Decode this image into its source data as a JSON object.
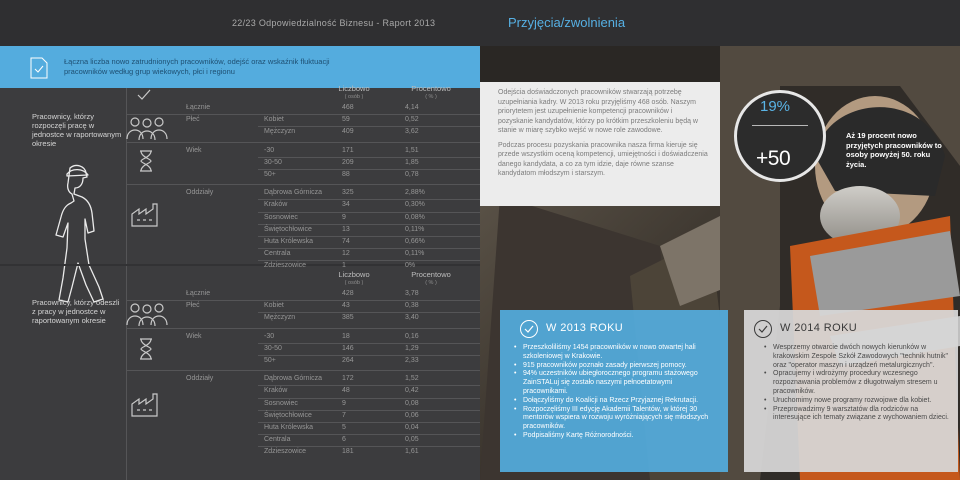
{
  "header": {
    "page_label": "22/23  Odpowiedzialność Biznesu - Raport 2013",
    "section_title": "Przyjęcia/zwolnienia"
  },
  "intro": {
    "text": "Łączna liczba nowo zatrudnionych pracowników, odejść oraz wskaźnik fluktuacji pracowników według grup wiekowych, płci i regionu"
  },
  "hired": {
    "label": "Pracownicy, którzy rozpoczęli pracę w jednostce w raportowanym okresie",
    "col_count": "Liczbowo",
    "col_count_unit": "( osób )",
    "col_pct": "Procentowo",
    "col_pct_unit": "( % )",
    "total": {
      "label": "Łącznie",
      "count": "468",
      "pct": "4,14"
    },
    "gender": {
      "label": "Płeć",
      "rows": [
        {
          "name": "Kobiet",
          "count": "59",
          "pct": "0,52"
        },
        {
          "name": "Mężczyzn",
          "count": "409",
          "pct": "3,62"
        }
      ]
    },
    "age": {
      "label": "Wiek",
      "rows": [
        {
          "name": "-30",
          "count": "171",
          "pct": "1,51"
        },
        {
          "name": "30-50",
          "count": "209",
          "pct": "1,85"
        },
        {
          "name": "50+",
          "count": "88",
          "pct": "0,78"
        }
      ]
    },
    "branches": {
      "label": "Oddziały",
      "rows": [
        {
          "name": "Dąbrowa Górnicza",
          "count": "325",
          "pct": "2,88%"
        },
        {
          "name": "Kraków",
          "count": "34",
          "pct": "0,30%"
        },
        {
          "name": "Sosnowiec",
          "count": "9",
          "pct": "0,08%"
        },
        {
          "name": "Świętochłowice",
          "count": "13",
          "pct": "0,11%"
        },
        {
          "name": "Huta Królewska",
          "count": "74",
          "pct": "0,66%"
        },
        {
          "name": "Centrala",
          "count": "12",
          "pct": "0,11%"
        },
        {
          "name": "Zdzieszowice",
          "count": "1",
          "pct": "0%"
        }
      ]
    }
  },
  "left": {
    "label": "Pracownicy, którzy odeszli z pracy w jednostce w raportowanym okresie",
    "col_count": "Liczbowo",
    "col_count_unit": "( osób )",
    "col_pct": "Procentowo",
    "col_pct_unit": "( % )",
    "total": {
      "label": "Łącznie",
      "count": "428",
      "pct": "3,78"
    },
    "gender": {
      "label": "Płeć",
      "rows": [
        {
          "name": "Kobiet",
          "count": "43",
          "pct": "0,38"
        },
        {
          "name": "Mężczyzn",
          "count": "385",
          "pct": "3,40"
        }
      ]
    },
    "age": {
      "label": "Wiek",
      "rows": [
        {
          "name": "-30",
          "count": "18",
          "pct": "0,16"
        },
        {
          "name": "30-50",
          "count": "146",
          "pct": "1,29"
        },
        {
          "name": "50+",
          "count": "264",
          "pct": "2,33"
        }
      ]
    },
    "branches": {
      "label": "Oddziały",
      "rows": [
        {
          "name": "Dąbrowa Górnicza",
          "count": "172",
          "pct": "1,52"
        },
        {
          "name": "Kraków",
          "count": "48",
          "pct": "0,42"
        },
        {
          "name": "Sosnowiec",
          "count": "9",
          "pct": "0,08"
        },
        {
          "name": "Świętochłowice",
          "count": "7",
          "pct": "0,06"
        },
        {
          "name": "Huta Królewska",
          "count": "5",
          "pct": "0,04"
        },
        {
          "name": "Centrala",
          "count": "6",
          "pct": "0,05"
        },
        {
          "name": "Zdzieszowice",
          "count": "181",
          "pct": "1,61"
        }
      ]
    }
  },
  "info_box": {
    "p1": "Odejścia doświadczonych pracowników stwarzają potrzebę uzupełniania kadry. W 2013 roku przyjęliśmy 468 osób. Naszym priorytetem jest uzupełnienie kompetencji pracowników i pozyskanie kandydatów, którzy po krótkim przeszkoleniu będą w stanie w miarę szybko wejść w nowe role zawodowe.",
    "p2": "Podczas procesu pozyskania pracownika nasza firma kieruje się przede wszystkim oceną kompetencji, umiejętności i doświadczenia danego kandydata, a co za tym idzie, daje równe szanse kandydatom młodszym i starszym."
  },
  "stat": {
    "percent": "19%",
    "age": "+50",
    "text": "Aż 19 procent nowo przyjętych pracowników to osoby powyżej 50. roku życia."
  },
  "year2013": {
    "title": "W 2013 ROKU",
    "items": [
      "Przeszkoliliśmy 1454 pracowników w nowo otwartej hali szkoleniowej w Krakowie.",
      "915 pracowników poznało zasady pierwszej pomocy.",
      "94% uczestników ubiegłorocznego programu stażowego ZainSTALuj się zostało naszymi pełnoetatowymi pracownikami.",
      "Dołączyliśmy do Koalicji na Rzecz Przyjaznej Rekrutacji.",
      "Rozpoczęliśmy III edycję Akademii Talentów, w której 30 mentorów wspiera w rozwoju wyróżniających się młodszych pracowników.",
      "Podpisaliśmy Kartę Różnorodności."
    ]
  },
  "year2014": {
    "title": "W 2014 ROKU",
    "items": [
      "Wesprzemy otwarcie dwóch nowych kierunków w krakowskim Zespole Szkół Zawodowych \"technik hutnik\" oraz \"operator maszyn i urządzeń metalurgicznych\".",
      "Opracujemy i wdrożymy procedury wczesnego rozpoznawania problemów z długotrwałym stresem u pracowników.",
      "Uruchomimy nowe programy rozwojowe dla kobiet.",
      "Przeprowadzimy 9 warsztatów dla rodziców na interesujące ich tematy związane z wychowaniem dzieci."
    ]
  },
  "colors": {
    "accent": "#54acde",
    "title_blue": "#56b0e4",
    "panel": "#3c3c3e",
    "background": "#2e2e30"
  }
}
